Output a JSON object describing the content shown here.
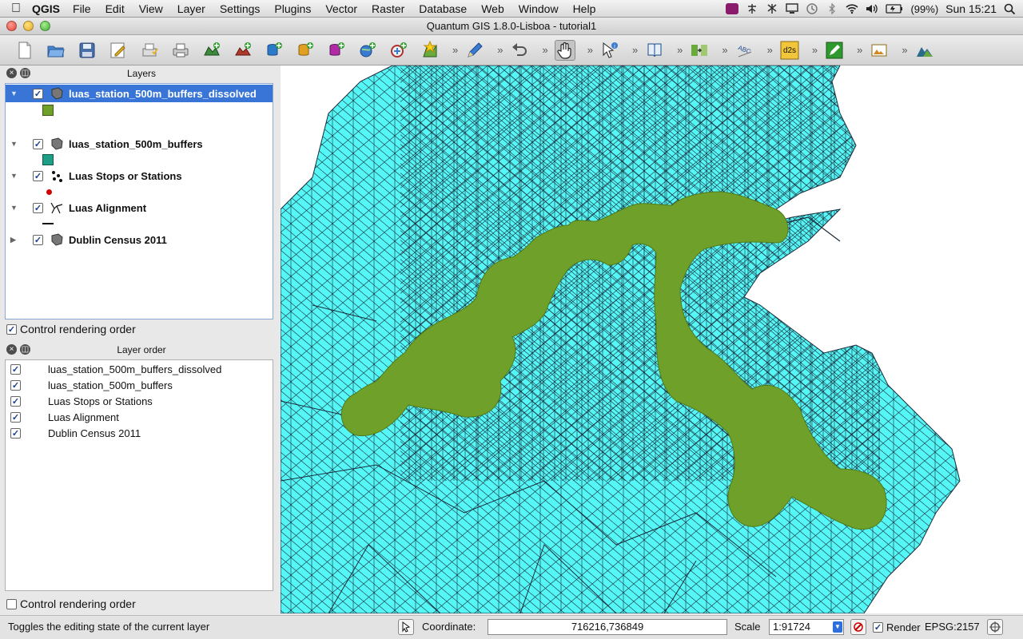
{
  "menubar": {
    "app_name": "QGIS",
    "items": [
      "File",
      "Edit",
      "View",
      "Layer",
      "Settings",
      "Plugins",
      "Vector",
      "Raster",
      "Database",
      "Web",
      "Window",
      "Help"
    ],
    "battery": "(99%)",
    "clock": "Sun 15:21"
  },
  "window": {
    "title": "Quantum GIS 1.8.0-Lisboa - tutorial1"
  },
  "layers_panel": {
    "title": "Layers",
    "layers": [
      {
        "name": "luas_station_500m_buffers_dissolved",
        "checked": true,
        "selected": true,
        "legend_color": "#6fa12a"
      },
      {
        "name": "luas_station_500m_buffers",
        "checked": true,
        "selected": false,
        "legend_color": "#1e9e86"
      },
      {
        "name": "Luas Stops or Stations",
        "checked": true,
        "selected": false,
        "legend_color": "#d00000"
      },
      {
        "name": "Luas Alignment",
        "checked": true,
        "selected": false,
        "legend_color": "#111111"
      },
      {
        "name": "Dublin Census 2011",
        "checked": true,
        "selected": false,
        "legend_color": ""
      }
    ],
    "control_rendering_order": "Control rendering order"
  },
  "layer_order_panel": {
    "title": "Layer order",
    "items": [
      "luas_station_500m_buffers_dissolved",
      "luas_station_500m_buffers",
      "Luas Stops or Stations",
      "Luas Alignment",
      "Dublin Census 2011"
    ],
    "control_rendering_order": "Control rendering order"
  },
  "map": {
    "land_color": "#55f7f6",
    "buffer_color": "#6fa12a",
    "boundary_color": "#1b2a3a"
  },
  "statusbar": {
    "message": "Toggles the editing state of the current layer",
    "coordinate_label": "Coordinate:",
    "coordinate_value": "716216,736849",
    "scale_label": "Scale",
    "scale_value": "1:91724",
    "render_label": "Render",
    "crs": "EPSG:2157"
  }
}
